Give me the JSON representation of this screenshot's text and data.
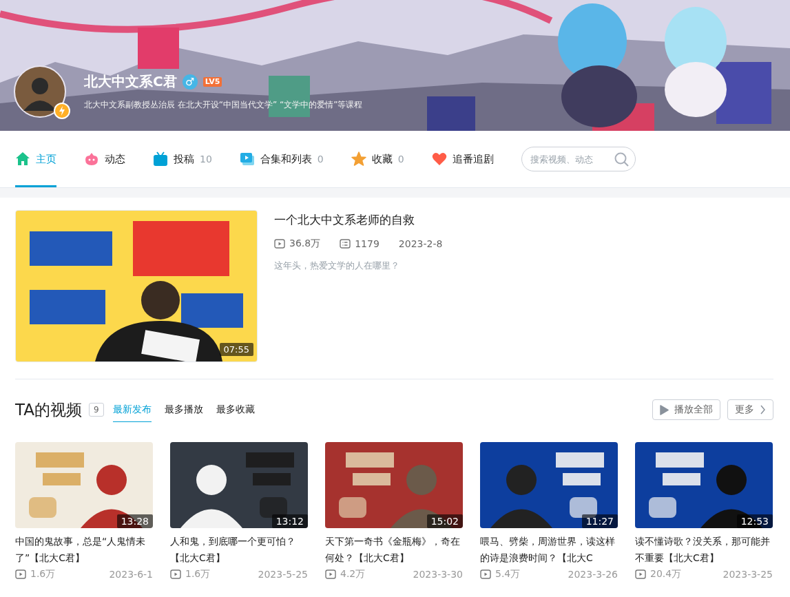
{
  "profile": {
    "name": "北大中文系C君",
    "gender": "♂",
    "level": "LV5",
    "bio": "北大中文系副教授丛治辰 在北大开设“中国当代文学” “文学中的爱情”等课程",
    "verified": true
  },
  "nav": {
    "tabs": [
      {
        "label": "主页",
        "kind": "home",
        "selected": true
      },
      {
        "label": "动态",
        "kind": "dynamic",
        "selected": false
      },
      {
        "label": "投稿",
        "kind": "upload",
        "count": "10",
        "selected": false
      },
      {
        "label": "合集和列表",
        "kind": "collection",
        "count": "0",
        "selected": false
      },
      {
        "label": "收藏",
        "kind": "favorite",
        "count": "0",
        "selected": false
      },
      {
        "label": "追番追剧",
        "kind": "bangumi",
        "selected": false
      }
    ],
    "search": {
      "placeholder": "搜索视频、动态"
    }
  },
  "featured": {
    "title": "一个北大中文系老师的自救",
    "views": "36.8万",
    "comments": "1179",
    "date": "2023-2-8",
    "description": "这年头，热爱文学的人在哪里？",
    "duration": "07:55"
  },
  "videos_section": {
    "title": "TA的视频",
    "count": "9",
    "sort_tabs": [
      {
        "label": "最新发布",
        "selected": true
      },
      {
        "label": "最多播放",
        "selected": false
      },
      {
        "label": "最多收藏",
        "selected": false
      }
    ],
    "buttons": [
      {
        "label": "播放全部",
        "kind": "play"
      },
      {
        "label": "更多",
        "kind": "more"
      }
    ]
  },
  "videos": [
    {
      "title": "中国的鬼故事，总是“人鬼情未了”【北大C君】",
      "duration": "13:28",
      "views": "1.6万",
      "date": "2023-6-1"
    },
    {
      "title": "人和鬼，到底哪一个更可怕？【北大C君】",
      "duration": "13:12",
      "views": "1.6万",
      "date": "2023-5-25"
    },
    {
      "title": "天下第一奇书《金瓶梅》，奇在何处？【北大C君】",
      "duration": "15:02",
      "views": "4.2万",
      "date": "2023-3-30"
    },
    {
      "title": "喂马、劈柴，周游世界，读这样的诗是浪费时间？【北大C",
      "duration": "11:27",
      "views": "5.4万",
      "date": "2023-3-26"
    },
    {
      "title": "读不懂诗歌？没关系，那可能并不重要【北大C君】",
      "duration": "12:53",
      "views": "20.4万",
      "date": "2023-3-25"
    }
  ]
}
